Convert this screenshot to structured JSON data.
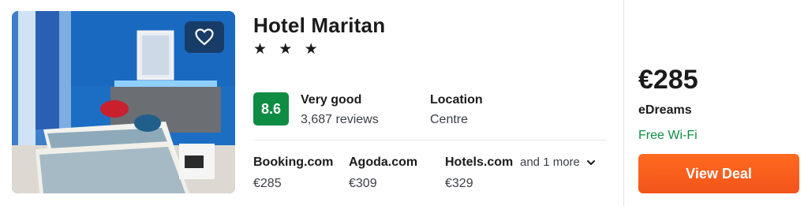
{
  "hotel": {
    "name": "Hotel Maritan",
    "stars": "★ ★ ★"
  },
  "rating": {
    "score": "8.6",
    "label": "Very good",
    "reviews": "3,687 reviews"
  },
  "location": {
    "label": "Location",
    "value": "Centre"
  },
  "providers": [
    {
      "name": "Booking.com",
      "price": "€285"
    },
    {
      "name": "Agoda.com",
      "price": "€309"
    },
    {
      "name": "Hotels.com",
      "price": "€329"
    }
  ],
  "more_providers": "and 1 more",
  "best_deal": {
    "price": "€285",
    "site": "eDreams",
    "amenity": "Free Wi-Fi",
    "button_label": "View Deal"
  },
  "icons": {
    "favorite": "heart-icon",
    "expand": "chevron-down-icon",
    "hotel_photo": "hotel-room-photo"
  },
  "colors": {
    "score_badge": "#0f8c44",
    "cta": "#f2541b",
    "amenity_text": "#0f8c44"
  }
}
